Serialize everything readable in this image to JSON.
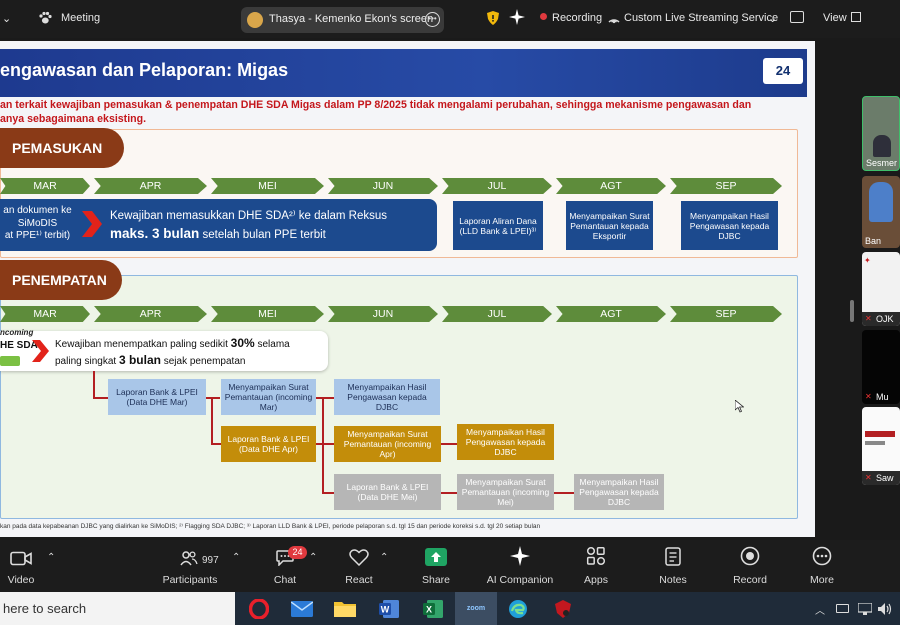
{
  "topbar": {
    "meeting_label": "Meeting",
    "screen_share_label": "Thasya - Kemenko Ekon's screen",
    "recording_label": "Recording",
    "streaming_label": "Custom Live Streaming Service",
    "view_label": "View"
  },
  "slide": {
    "page_number": "24",
    "title": "engawasan dan Pelaporan: Migas",
    "intro_line1": "an terkait kewajiban pemasukan & penempatan DHE SDA Migas dalam PP 8/2025 tidak mengalami perubahan, sehingga mekanisme pengawasan dan",
    "intro_line2": "anya sebagaimana eksisting.",
    "pemasukan": {
      "heading": "PEMASUKAN",
      "months": [
        "MAR",
        "APR",
        "MEI",
        "JUN",
        "JUL",
        "AGT",
        "SEP"
      ],
      "left_text_1": "an dokumen ke",
      "left_text_2": "SiMoDIS",
      "left_text_3": "at PPE¹⁾ terbit)",
      "main_text_1": "Kewajiban memasukkan DHE SDA²⁾ ke dalam Reksus",
      "main_text_2a": "maks. 3 bulan",
      "main_text_2b": " setelah bulan PPE terbit",
      "box_jul": "Laporan Aliran Dana (LLD Bank & LPEI)³⁾",
      "box_agt": "Menyampaikan Surat Pemantauan kepada Eksportir",
      "box_sep": "Menyampaikan Hasil Pengawasan kepada DJBC"
    },
    "penempatan": {
      "heading": "PENEMPATAN",
      "months": [
        "MAR",
        "APR",
        "MEI",
        "JUN",
        "JUL",
        "AGT",
        "SEP"
      ],
      "incoming_1": "ncoming",
      "incoming_2": "HE SDA",
      "callout_1a": "Kewajiban menempatkan paling sedikit ",
      "callout_1b": "30%",
      "callout_1c": " selama",
      "callout_2a": "paling singkat ",
      "callout_2b": "3 bulan",
      "callout_2c": " sejak penempatan",
      "r1_a": "Laporan Bank & LPEI (Data DHE Mar)",
      "r1_b": "Menyampaikan Surat Pemantauan (incoming Mar)",
      "r1_c": "Menyampaikan Hasil Pengawasan kepada DJBC",
      "r2_a": "Laporan Bank & LPEI (Data DHE Apr)",
      "r2_b": "Menyampaikan Surat Pemantauan (incoming Apr)",
      "r2_c": "Menyampaikan Hasil Pengawasan kepada DJBC",
      "r3_a": "Laporan Bank & LPEI (Data DHE Mei)",
      "r3_b": "Menyampaikan Surat Pemantauan (incoming Mei)",
      "r3_c": "Menyampaikan Hasil Pengawasan kepada DJBC"
    },
    "footnote": "kan pada data kepabeanan DJBC yang dialirkan ke SiMoDIS;  ²⁾ Flagging SDA DJBC;  ³⁾ Laporan LLD Bank & LPEI, periode pelaporan s.d. tgl 15 dan periode koreksi s.d. tgl  20 setiap bulan"
  },
  "participants_strip": [
    "Sesmer",
    "Ban",
    "OJK",
    "Mu",
    "Saw"
  ],
  "toolbar": {
    "video": "Video",
    "participants": "Participants",
    "participants_count": "997",
    "chat": "Chat",
    "chat_badge": "24",
    "react": "React",
    "share": "Share",
    "ai": "AI Companion",
    "apps": "Apps",
    "notes": "Notes",
    "record": "Record",
    "more": "More"
  },
  "taskbar": {
    "search_placeholder": "here to search",
    "zoom_label": "zoom"
  },
  "colors": {
    "title_blue": "#1e3a8f",
    "accent_red": "#c4171c",
    "month_green": "#5e8c3b",
    "pill_brown": "#8a3a17",
    "share_green": "#1fa463"
  }
}
